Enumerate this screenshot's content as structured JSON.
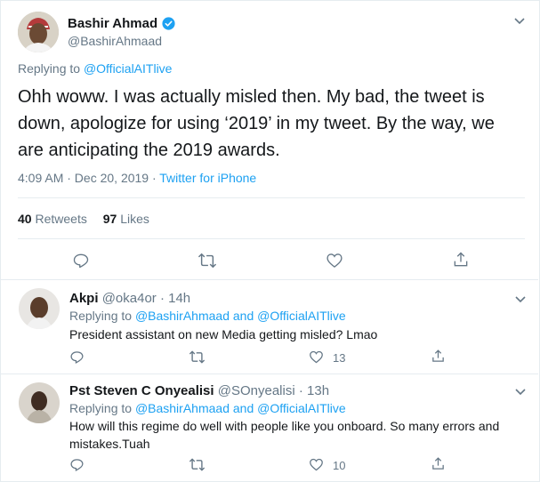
{
  "main_tweet": {
    "display_name": "Bashir Ahmad",
    "handle": "@BashirAhmaad",
    "replying_prefix": "Replying to",
    "replying_to": "@OfficialAITlive",
    "text": "Ohh woww. I was actually misled then. My bad, the tweet is down, apologize for using ‘2019’ in my tweet. By the way, we are anticipating the 2019 awards.",
    "timestamp": "4:09 AM · Dec 20, 2019 ·",
    "source": "Twitter for iPhone",
    "retweets_count": "40",
    "retweets_label": "Retweets",
    "likes_count": "97",
    "likes_label": "Likes"
  },
  "replies": [
    {
      "display_name": "Akpi",
      "handle": "@oka4or",
      "time": "· 14h",
      "replying_prefix": "Replying to",
      "replying_to": "@BashirAhmaad and @OfficialAITlive",
      "text": "President assistant on new Media getting misled? Lmao",
      "like_count": "13"
    },
    {
      "display_name": "Pst Steven C Onyealisi",
      "handle": "@SOnyealisi",
      "time": "· 13h",
      "replying_prefix": "Replying to",
      "replying_to": "@BashirAhmaad and @OfficialAITlive",
      "text": "How will this regime do well with people like you onboard. So many errors and mistakes.Tuah",
      "like_count": "10"
    }
  ],
  "colors": {
    "accent": "#1da1f2",
    "muted": "#657786",
    "border": "#e6ecf0",
    "text": "#14171a"
  },
  "icons": [
    "verified-badge-icon",
    "chevron-down-icon",
    "reply-icon",
    "retweet-icon",
    "like-icon",
    "share-icon"
  ]
}
